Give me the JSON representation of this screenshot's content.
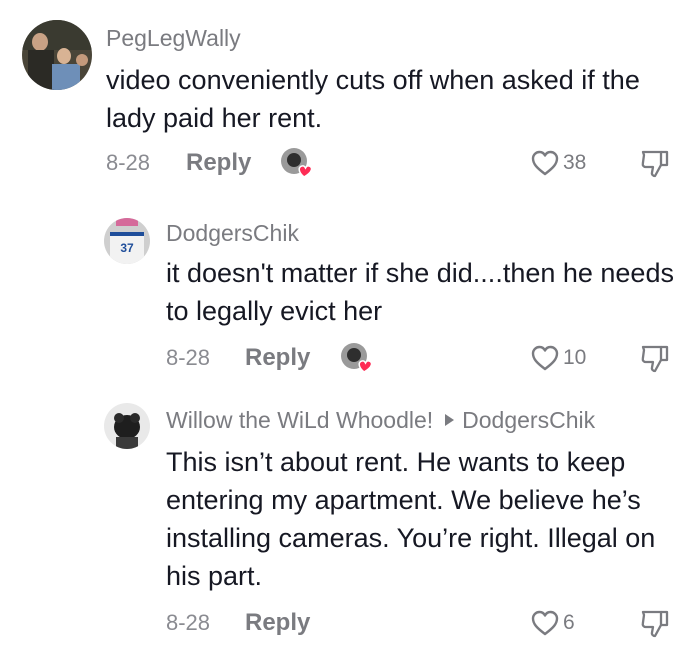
{
  "comments": [
    {
      "username": "PegLegWally",
      "text": "video conveniently cuts off when asked if the lady paid her rent.",
      "date": "8-28",
      "reply_label": "Reply",
      "likes": "38"
    },
    {
      "username": "DodgersChik",
      "text": "it doesn't matter if she did....then he needs to legally evict her",
      "date": "8-28",
      "reply_label": "Reply",
      "likes": "10",
      "jersey_number": "37"
    },
    {
      "username": "Willow the WiLd Whoodle!",
      "reply_to": "DodgersChik",
      "text": "This isn’t about rent. He wants to keep entering my apartment. We believe he’s installing cameras. You’re right. Illegal on his part.",
      "date": "8-28",
      "reply_label": "Reply",
      "likes": "6"
    }
  ],
  "colors": {
    "text": "#161823",
    "muted": "#7a7b80",
    "heart_badge": "#fe2c55"
  },
  "icons": {
    "like": "heart-outline-icon",
    "dislike": "thumbs-down-outline-icon",
    "creator_liked": "creator-liked-badge-icon"
  }
}
